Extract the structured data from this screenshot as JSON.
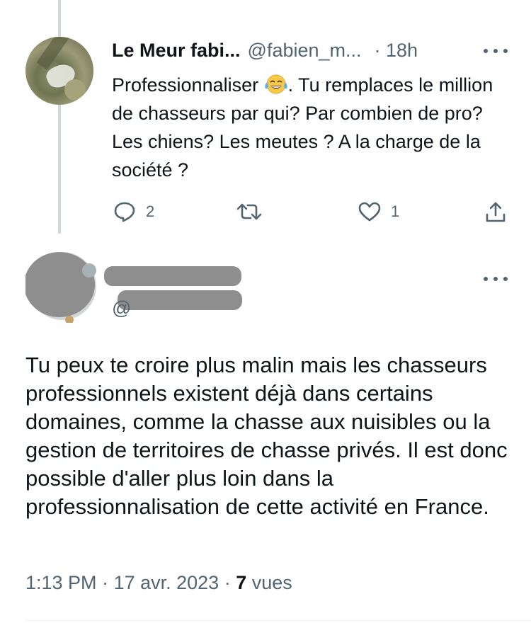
{
  "reply": {
    "display_name": "Le Meur fabi...",
    "handle": "@fabien_m...",
    "time": "· 18h",
    "text_before_emoji": "Professionnaliser ",
    "emoji_name": "face-with-tears-of-joy-emoji",
    "text_after_emoji": ". Tu remplaces le million de chasseurs par qui? Par combien de pro? Les chiens? Les meutes ? A la charge de la société ?",
    "reply_count": "2",
    "retweet_count": "",
    "like_count": "1"
  },
  "main": {
    "handle_partial": "@",
    "text": "Tu peux te croire plus malin mais les chasseurs professionnels existent déjà dans certains domaines, comme la chasse aux nuisibles ou la gestion de territoires de chasse privés. Il est donc possible d'aller plus loin dans la professionnalisation de cette activité en France.",
    "time": "1:13 PM",
    "date": "17 avr. 2023",
    "views_count": "7",
    "views_label": "vues"
  },
  "colors": {
    "text": "#0f1419",
    "secondary": "#536471",
    "thread_line": "#cfd9de",
    "redaction": "#8e8e8e"
  },
  "icons": [
    "more-icon",
    "reply-icon",
    "retweet-icon",
    "like-icon",
    "share-icon"
  ]
}
